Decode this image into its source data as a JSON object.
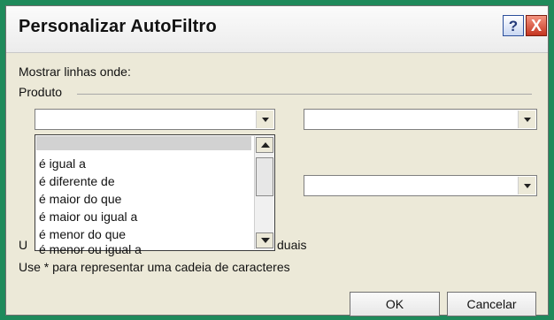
{
  "window": {
    "title": "Personalizar AutoFiltro",
    "help_label": "?",
    "close_label": "X"
  },
  "form": {
    "show_rows_label": "Mostrar linhas onde:",
    "field_label": "Produto",
    "dropdown_options": [
      "",
      "é igual a",
      "é diferente de",
      "é maior do que",
      "é maior ou igual a",
      "é menor do que",
      "é menor ou igual a"
    ],
    "hint_1_visible_start": "U",
    "hint_1_visible_end": "duais",
    "hint_2": "Use * para representar uma cadeia de caracteres"
  },
  "buttons": {
    "ok": "OK",
    "cancel": "Cancelar"
  }
}
